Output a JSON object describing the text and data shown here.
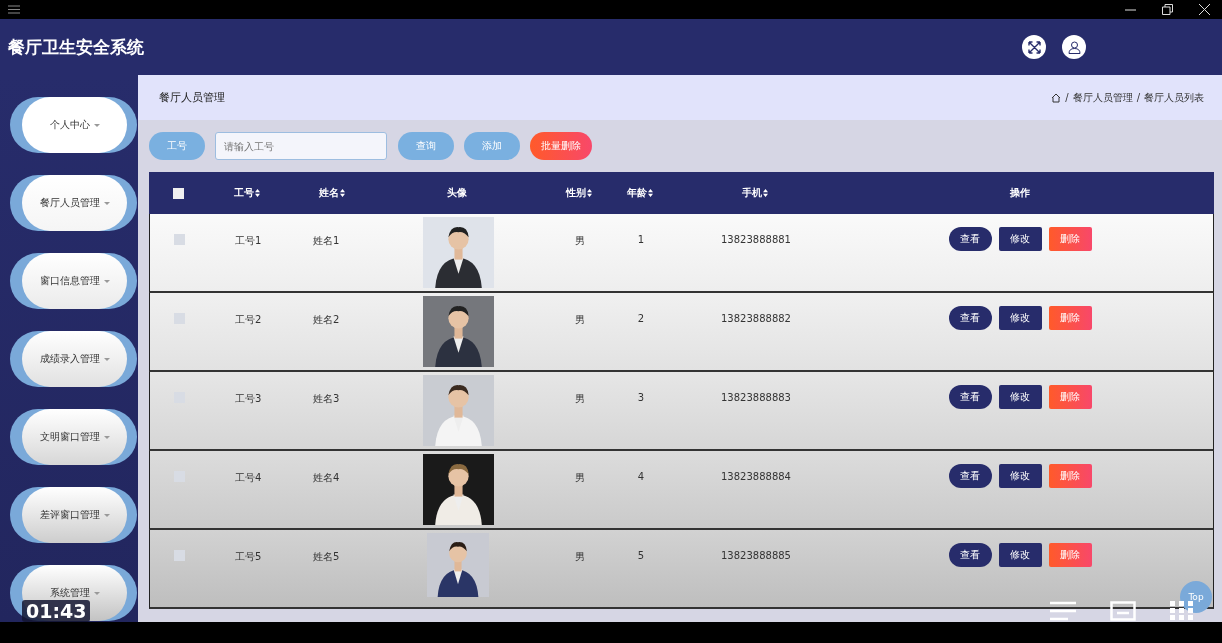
{
  "app": {
    "title": "餐厅卫生安全系统"
  },
  "sidebar": {
    "items": [
      {
        "label": "个人中心"
      },
      {
        "label": "餐厅人员管理"
      },
      {
        "label": "窗口信息管理"
      },
      {
        "label": "成绩录入管理"
      },
      {
        "label": "文明窗口管理"
      },
      {
        "label": "差评窗口管理"
      },
      {
        "label": "系统管理"
      }
    ]
  },
  "page": {
    "title": "餐厅人员管理",
    "breadcrumb": [
      {
        "separator": "/",
        "label": "餐厅人员管理"
      },
      {
        "separator": "/",
        "label": "餐厅人员列表"
      }
    ]
  },
  "toolbar": {
    "filter_label": "工号",
    "search": {
      "placeholder": "请输入工号"
    },
    "buttons": [
      {
        "label": "查询",
        "kind": "normal"
      },
      {
        "label": "添加",
        "kind": "normal"
      },
      {
        "label": "批量删除",
        "kind": "danger"
      }
    ]
  },
  "table": {
    "select_all": {
      "checked": false
    },
    "columns": [
      {
        "label": "工号",
        "sortable": true
      },
      {
        "label": "姓名",
        "sortable": true
      },
      {
        "label": "头像",
        "sortable": false
      },
      {
        "label": "性别",
        "sortable": true
      },
      {
        "label": "年龄",
        "sortable": true
      },
      {
        "label": "手机",
        "sortable": true
      },
      {
        "label": "操作",
        "sortable": false
      }
    ],
    "rows": [
      {
        "checked": false,
        "id": "工号1",
        "name": "姓名1",
        "gender": "男",
        "age": "1",
        "phone": "13823888881",
        "actions": [
          "查看",
          "修改",
          "删除"
        ]
      },
      {
        "checked": false,
        "id": "工号2",
        "name": "姓名2",
        "gender": "男",
        "age": "2",
        "phone": "13823888882",
        "actions": [
          "查看",
          "修改",
          "删除"
        ]
      },
      {
        "checked": false,
        "id": "工号3",
        "name": "姓名3",
        "gender": "男",
        "age": "3",
        "phone": "13823888883",
        "actions": [
          "查看",
          "修改",
          "删除"
        ]
      },
      {
        "checked": false,
        "id": "工号4",
        "name": "姓名4",
        "gender": "男",
        "age": "4",
        "phone": "13823888884",
        "actions": [
          "查看",
          "修改",
          "删除"
        ]
      },
      {
        "checked": false,
        "id": "工号5",
        "name": "姓名5",
        "gender": "男",
        "age": "5",
        "phone": "13823888885",
        "actions": [
          "查看",
          "修改",
          "删除"
        ]
      }
    ]
  },
  "back_to_top": "Top",
  "player": {
    "time": "01:43"
  }
}
